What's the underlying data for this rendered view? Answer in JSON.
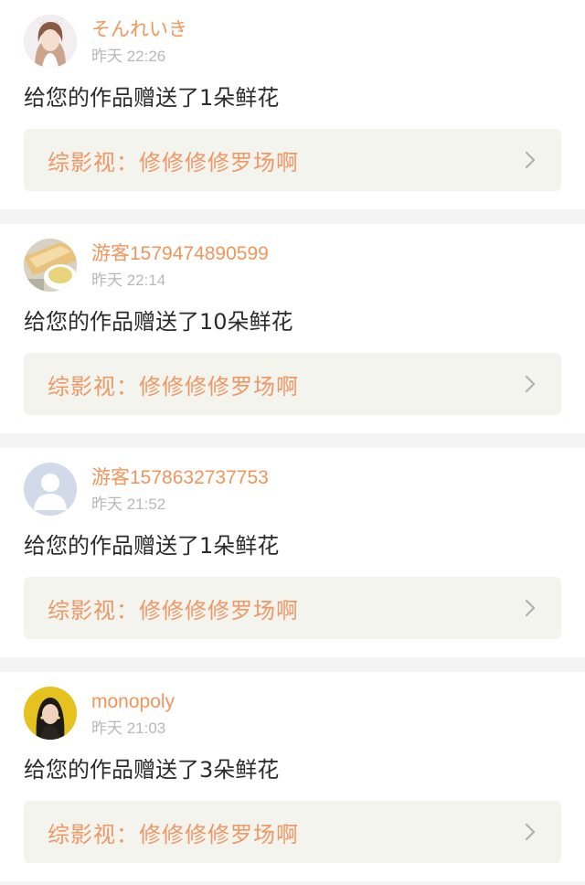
{
  "notifications": [
    {
      "username": "そんれいき",
      "time": "昨天 22:26",
      "message": "给您的作品赠送了1朵鲜花",
      "work_title": "综影视：修修修修罗场啊",
      "avatar": "anime-girl-white-hair"
    },
    {
      "username": "游客1579474890599",
      "time": "昨天 22:14",
      "message": "给您的作品赠送了10朵鲜花",
      "work_title": "综影视：修修修修罗场啊",
      "avatar": "tea-cup-photo"
    },
    {
      "username": "游客1578632737753",
      "time": "昨天 21:52",
      "message": "给您的作品赠送了1朵鲜花",
      "work_title": "综影视：修修修修罗场啊",
      "avatar": "default-person"
    },
    {
      "username": "monopoly",
      "time": "昨天 21:03",
      "message": "给您的作品赠送了3朵鲜花",
      "work_title": "综影视：修修修修罗场啊",
      "avatar": "woman-yellow-background"
    }
  ],
  "colors": {
    "accent": "#f0965c",
    "link_background": "#f4f4ee",
    "page_background": "#f4f4f4",
    "timestamp": "#b8b8b8"
  }
}
